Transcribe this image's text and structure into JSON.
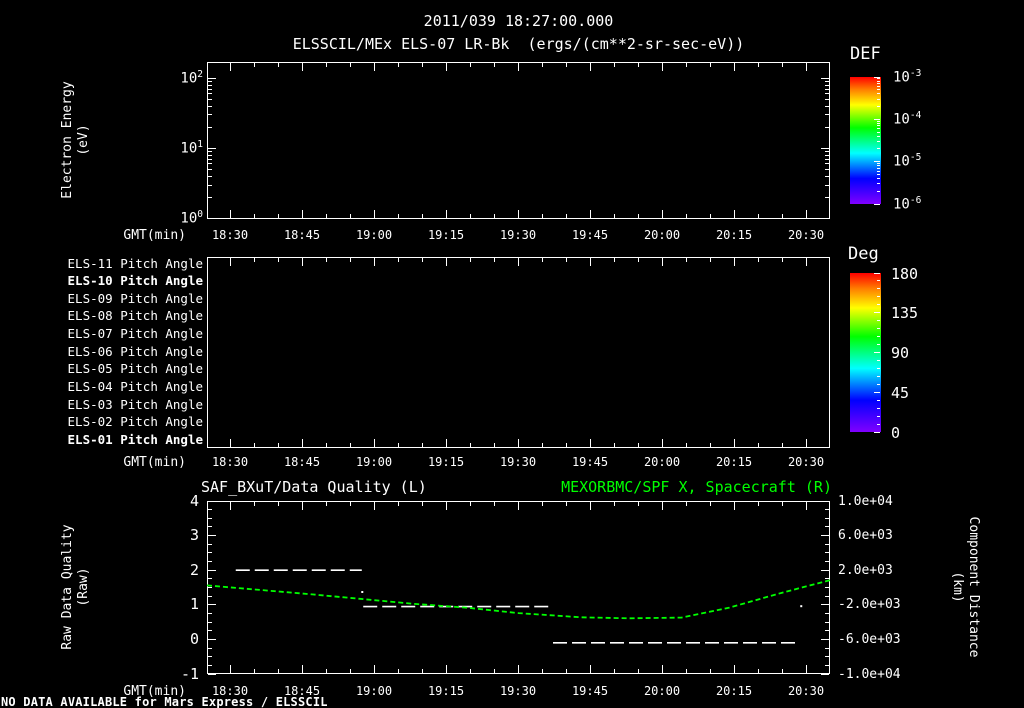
{
  "header": {
    "timestamp": "2011/039 18:27:00.000",
    "instrument_title": "ELSSCIL/MEx ELS-07 LR-Bk  (ergs/(cm**2-sr-sec-eV))"
  },
  "footer": {
    "no_data_message": "NO DATA AVAILABLE for Mars Express / ELSSCIL"
  },
  "colors": {
    "background": "#000000",
    "foreground": "#ffffff",
    "series_green": "#00ff00",
    "colorbar_gradient": [
      "#ff0000",
      "#ff8000",
      "#ffff00",
      "#00ff00",
      "#00ffff",
      "#0000ff",
      "#8000ff"
    ]
  },
  "time_axis": {
    "label": "GMT(min)",
    "start": "18:25",
    "end": "20:35",
    "major_ticks": [
      "18:30",
      "18:45",
      "19:00",
      "19:15",
      "19:30",
      "19:45",
      "20:00",
      "20:15",
      "20:30"
    ],
    "minor_step_minutes": 5
  },
  "panel_energy": {
    "ylabel_line1": "Electron Energy",
    "ylabel_line2": "(eV)",
    "ytick_exponents": [
      "2",
      "1",
      "0"
    ],
    "colorbar": {
      "title": "DEF",
      "tick_exponents": [
        "-3",
        "-4",
        "-5",
        "-6"
      ]
    }
  },
  "panel_pitch": {
    "rows": [
      {
        "label": "ELS-11 Pitch Angle",
        "bold": false
      },
      {
        "label": "ELS-10 Pitch Angle",
        "bold": true
      },
      {
        "label": "ELS-09 Pitch Angle",
        "bold": false
      },
      {
        "label": "ELS-08 Pitch Angle",
        "bold": false
      },
      {
        "label": "ELS-07 Pitch Angle",
        "bold": false
      },
      {
        "label": "ELS-06 Pitch Angle",
        "bold": false
      },
      {
        "label": "ELS-05 Pitch Angle",
        "bold": false
      },
      {
        "label": "ELS-04 Pitch Angle",
        "bold": false
      },
      {
        "label": "ELS-03 Pitch Angle",
        "bold": false
      },
      {
        "label": "ELS-02 Pitch Angle",
        "bold": false
      },
      {
        "label": "ELS-01 Pitch Angle",
        "bold": true
      }
    ],
    "colorbar": {
      "title": "Deg",
      "ticks": [
        "180",
        "135",
        "90",
        "45",
        "0"
      ]
    }
  },
  "panel_quality": {
    "title_left": "SAF_BXuT/Data Quality (L)",
    "title_right": "MEXORBMC/SPF X, Spacecraft (R)",
    "ylabel_left_line1": "Raw Data Quality",
    "ylabel_left_line2": "(Raw)",
    "ylabel_right_line1": "Component Distance",
    "ylabel_right_line2": "(km)",
    "yticks_left": [
      "4",
      "3",
      "2",
      "1",
      "0",
      "-1"
    ],
    "yticks_right": [
      "1.0e+04",
      "6.0e+03",
      "2.0e+03",
      "-2.0e+03",
      "-6.0e+03",
      "-1.0e+04"
    ]
  },
  "chart_data": [
    {
      "type": "heatmap",
      "panel": "electron-energy-spectrogram",
      "title": "ELSSCIL/MEx ELS-07 LR-Bk (ergs/(cm**2-sr-sec-eV))",
      "xlabel": "GMT(min)",
      "x_range": [
        "18:25",
        "20:35"
      ],
      "x_ticks": [
        "18:30",
        "18:45",
        "19:00",
        "19:15",
        "19:30",
        "19:45",
        "20:00",
        "20:15",
        "20:30"
      ],
      "ylabel": "Electron Energy (eV)",
      "y_scale": "log",
      "y_ticks": [
        "10^0",
        "10^1",
        "10^2"
      ],
      "colorbar": {
        "title": "DEF",
        "scale": "log",
        "tick_labels": [
          "10^-3",
          "10^-4",
          "10^-5",
          "10^-6"
        ]
      },
      "values": [],
      "status": "no data plotted"
    },
    {
      "type": "heatmap",
      "panel": "pitch-angle",
      "xlabel": "GMT(min)",
      "x_range": [
        "18:25",
        "20:35"
      ],
      "x_ticks": [
        "18:30",
        "18:45",
        "19:00",
        "19:15",
        "19:30",
        "19:45",
        "20:00",
        "20:15",
        "20:30"
      ],
      "rows": [
        "ELS-11 Pitch Angle",
        "ELS-10 Pitch Angle",
        "ELS-09 Pitch Angle",
        "ELS-08 Pitch Angle",
        "ELS-07 Pitch Angle",
        "ELS-06 Pitch Angle",
        "ELS-05 Pitch Angle",
        "ELS-04 Pitch Angle",
        "ELS-03 Pitch Angle",
        "ELS-02 Pitch Angle",
        "ELS-01 Pitch Angle"
      ],
      "colorbar": {
        "title": "Deg",
        "range": [
          0,
          180
        ],
        "tick_labels": [
          180,
          135,
          90,
          45,
          0
        ]
      },
      "values": [],
      "status": "no data plotted"
    },
    {
      "type": "line",
      "panel": "quality-and-distance",
      "xlabel": "GMT(min)",
      "x_start": "18:25",
      "x_total_minutes": 130,
      "x_ticks": [
        "18:30",
        "18:45",
        "19:00",
        "19:15",
        "19:30",
        "19:45",
        "20:00",
        "20:15",
        "20:30"
      ],
      "left_axis": {
        "label": "Raw Data Quality (Raw)",
        "range": [
          -1,
          4
        ],
        "ticks": [
          4,
          3,
          2,
          1,
          0,
          -1
        ]
      },
      "right_axis": {
        "label": "Component Distance (km)",
        "range": [
          -10000,
          10000
        ],
        "ticks": [
          10000,
          6000,
          2000,
          -2000,
          -6000,
          -10000
        ]
      },
      "series": [
        {
          "name": "SAF_BXuT/Data Quality (L)",
          "axis": "left",
          "color": "#ffffff",
          "line_style": "dashed",
          "segments": [
            {
              "t_min": [
                6.0,
                32.3
              ],
              "value": 2.0
            },
            {
              "t_min": [
                32.6,
                71.6
              ],
              "value": 0.95
            },
            {
              "t_min": [
                72.2,
                123.6
              ],
              "value": -0.1
            }
          ],
          "isolated_points": [
            {
              "t_min": 32.4,
              "value": 1.37
            },
            {
              "t_min": 124.0,
              "value": 0.96
            }
          ]
        },
        {
          "name": "MEXORBMC/SPF X, Spacecraft (R)",
          "axis": "right",
          "color": "#00ff00",
          "line_style": "dashed",
          "points": [
            [
              0,
              240
            ],
            [
              11,
              -280
            ],
            [
              22,
              -800
            ],
            [
              33,
              -1360
            ],
            [
              43,
              -1880
            ],
            [
              54,
              -2320
            ],
            [
              65,
              -2960
            ],
            [
              78,
              -3440
            ],
            [
              88,
              -3560
            ],
            [
              99,
              -3480
            ],
            [
              109,
              -2320
            ],
            [
              120,
              -600
            ],
            [
              130,
              840
            ]
          ]
        }
      ]
    }
  ]
}
